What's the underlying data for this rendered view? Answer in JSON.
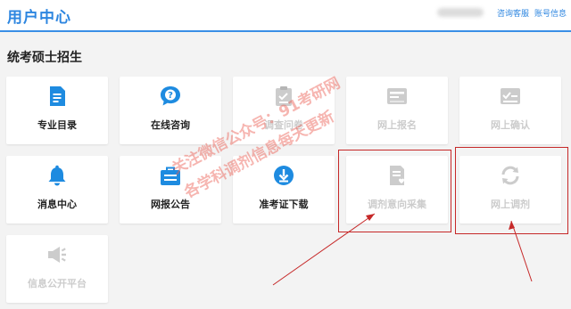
{
  "header": {
    "title": "用户中心",
    "links": [
      "咨询客服",
      "账号信息"
    ]
  },
  "section": {
    "title": "统考硕士招生"
  },
  "tiles": [
    {
      "label": "专业目录",
      "icon": "document-list-icon",
      "enabled": true
    },
    {
      "label": "在线咨询",
      "icon": "question-chat-icon",
      "enabled": true
    },
    {
      "label": "调查问卷",
      "icon": "clipboard-icon",
      "enabled": false
    },
    {
      "label": "网上报名",
      "icon": "id-card-icon",
      "enabled": false
    },
    {
      "label": "网上确认",
      "icon": "check-card-icon",
      "enabled": false
    },
    {
      "label": "消息中心",
      "icon": "bell-icon",
      "enabled": true
    },
    {
      "label": "网报公告",
      "icon": "briefcase-icon",
      "enabled": true
    },
    {
      "label": "准考证下载",
      "icon": "download-icon",
      "enabled": true
    },
    {
      "label": "调剂意向采集",
      "icon": "form-heart-icon",
      "enabled": false
    },
    {
      "label": "网上调剂",
      "icon": "refresh-icon",
      "enabled": false
    },
    {
      "label": "信息公开平台",
      "icon": "megaphone-icon",
      "enabled": false
    }
  ],
  "watermark": [
    "关注微信公众号：91考研网",
    "各学科调剂信息每天更新"
  ],
  "colors": {
    "accent": "#2d86e0",
    "icon_active": "#1e8be0",
    "icon_disabled": "#cccccc",
    "highlight": "#c62828",
    "watermark": "#eb5a50"
  }
}
